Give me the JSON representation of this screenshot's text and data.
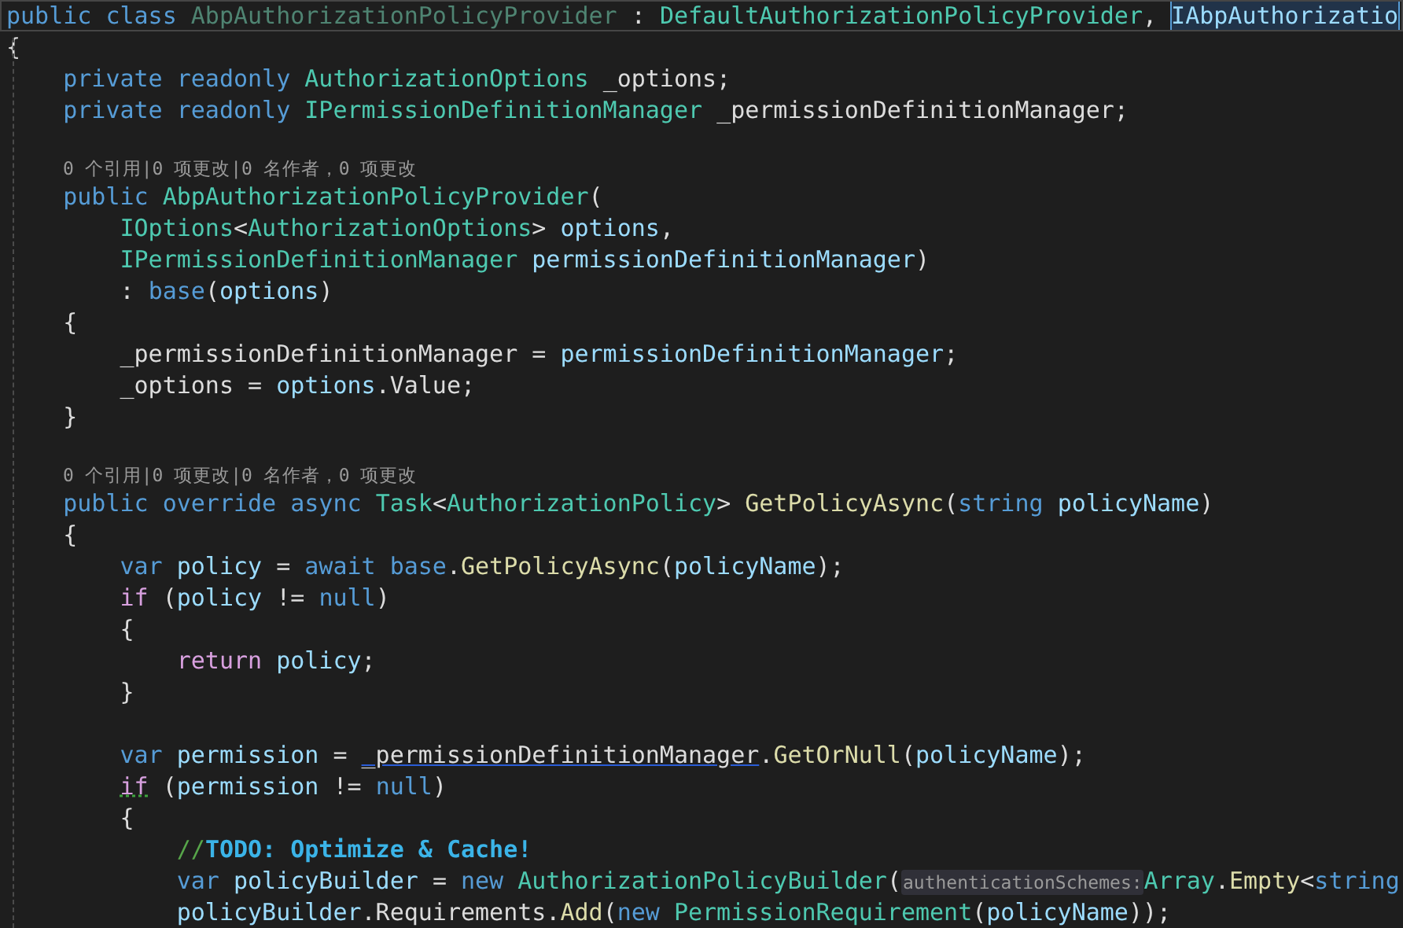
{
  "editor": {
    "lines": [
      {
        "kind": "code",
        "current": true,
        "tokens": [
          {
            "t": "public class ",
            "kind": "kw"
          },
          {
            "t": "AbpAuthorizationPolicyProvider",
            "kind": "dim"
          },
          {
            "t": " : ",
            "kind": "plain"
          },
          {
            "t": "DefaultAuthorizationPolicyProvider",
            "kind": "type"
          },
          {
            "t": ", ",
            "kind": "plain"
          },
          {
            "t": "IAbpAuthorizatio",
            "kind": "selected"
          }
        ]
      },
      {
        "kind": "code",
        "current": false,
        "tokens": [
          {
            "t": "{",
            "kind": "plain"
          }
        ]
      },
      {
        "kind": "code",
        "current": false,
        "tokens": [
          {
            "t": "    private readonly ",
            "kind": "kw"
          },
          {
            "t": "AuthorizationOptions",
            "kind": "type"
          },
          {
            "t": " _options;",
            "kind": "plain"
          }
        ]
      },
      {
        "kind": "code",
        "current": false,
        "tokens": [
          {
            "t": "    private readonly ",
            "kind": "kw"
          },
          {
            "t": "IPermissionDefinitionManager",
            "kind": "type"
          },
          {
            "t": " _permissionDefinitionManager;",
            "kind": "plain"
          }
        ]
      },
      {
        "kind": "blank"
      },
      {
        "kind": "lens",
        "text": "0 个引用|0 项更改|0 名作者，0 项更改"
      },
      {
        "kind": "code",
        "current": false,
        "tokens": [
          {
            "t": "    public ",
            "kind": "kw"
          },
          {
            "t": "AbpAuthorizationPolicyProvider",
            "kind": "type"
          },
          {
            "t": "(",
            "kind": "plain"
          }
        ]
      },
      {
        "kind": "code",
        "current": false,
        "tokens": [
          {
            "t": "        IOptions",
            "kind": "type"
          },
          {
            "t": "<",
            "kind": "plain"
          },
          {
            "t": "AuthorizationOptions",
            "kind": "type"
          },
          {
            "t": "> ",
            "kind": "plain"
          },
          {
            "t": "options",
            "kind": "param"
          },
          {
            "t": ",",
            "kind": "plain"
          }
        ]
      },
      {
        "kind": "code",
        "current": false,
        "tokens": [
          {
            "t": "        IPermissionDefinitionManager",
            "kind": "type"
          },
          {
            "t": " permissionDefinitionManager",
            "kind": "param"
          },
          {
            "t": ")",
            "kind": "plain"
          }
        ]
      },
      {
        "kind": "code",
        "current": false,
        "tokens": [
          {
            "t": "        : ",
            "kind": "plain"
          },
          {
            "t": "base",
            "kind": "kw"
          },
          {
            "t": "(",
            "kind": "plain"
          },
          {
            "t": "options",
            "kind": "param"
          },
          {
            "t": ")",
            "kind": "plain"
          }
        ]
      },
      {
        "kind": "code",
        "current": false,
        "tokens": [
          {
            "t": "    {",
            "kind": "plain"
          }
        ]
      },
      {
        "kind": "code",
        "current": false,
        "tokens": [
          {
            "t": "        _permissionDefinitionManager = ",
            "kind": "plain"
          },
          {
            "t": "permissionDefinitionManager",
            "kind": "param"
          },
          {
            "t": ";",
            "kind": "plain"
          }
        ]
      },
      {
        "kind": "code",
        "current": false,
        "tokens": [
          {
            "t": "        _options = ",
            "kind": "plain"
          },
          {
            "t": "options",
            "kind": "param"
          },
          {
            "t": ".Value;",
            "kind": "plain"
          }
        ]
      },
      {
        "kind": "code",
        "current": false,
        "tokens": [
          {
            "t": "    }",
            "kind": "plain"
          }
        ]
      },
      {
        "kind": "blank"
      },
      {
        "kind": "lens",
        "text": "0 个引用|0 项更改|0 名作者，0 项更改"
      },
      {
        "kind": "code",
        "current": false,
        "tokens": [
          {
            "t": "    public override async ",
            "kind": "kw"
          },
          {
            "t": "Task",
            "kind": "type"
          },
          {
            "t": "<",
            "kind": "plain"
          },
          {
            "t": "AuthorizationPolicy",
            "kind": "type"
          },
          {
            "t": "> ",
            "kind": "plain"
          },
          {
            "t": "GetPolicyAsync",
            "kind": "method"
          },
          {
            "t": "(",
            "kind": "plain"
          },
          {
            "t": "string",
            "kind": "kw"
          },
          {
            "t": " policyName",
            "kind": "param"
          },
          {
            "t": ")",
            "kind": "plain"
          }
        ]
      },
      {
        "kind": "code",
        "current": false,
        "tokens": [
          {
            "t": "    {",
            "kind": "plain"
          }
        ]
      },
      {
        "kind": "code",
        "current": false,
        "tokens": [
          {
            "t": "        var ",
            "kind": "kw"
          },
          {
            "t": "policy",
            "kind": "param"
          },
          {
            "t": " = ",
            "kind": "plain"
          },
          {
            "t": "await base",
            "kind": "kw"
          },
          {
            "t": ".",
            "kind": "plain"
          },
          {
            "t": "GetPolicyAsync",
            "kind": "method"
          },
          {
            "t": "(",
            "kind": "plain"
          },
          {
            "t": "policyName",
            "kind": "param"
          },
          {
            "t": ");",
            "kind": "plain"
          }
        ]
      },
      {
        "kind": "code",
        "current": false,
        "tokens": [
          {
            "t": "        if",
            "kind": "ctrl"
          },
          {
            "t": " (",
            "kind": "plain"
          },
          {
            "t": "policy",
            "kind": "param"
          },
          {
            "t": " != ",
            "kind": "plain"
          },
          {
            "t": "null",
            "kind": "kw"
          },
          {
            "t": ")",
            "kind": "plain"
          }
        ]
      },
      {
        "kind": "code",
        "current": false,
        "tokens": [
          {
            "t": "        {",
            "kind": "plain"
          }
        ]
      },
      {
        "kind": "code",
        "current": false,
        "tokens": [
          {
            "t": "            return",
            "kind": "ctrl"
          },
          {
            "t": " policy",
            "kind": "param"
          },
          {
            "t": ";",
            "kind": "plain"
          }
        ]
      },
      {
        "kind": "code",
        "current": false,
        "tokens": [
          {
            "t": "        }",
            "kind": "plain"
          }
        ]
      },
      {
        "kind": "blank"
      },
      {
        "kind": "code",
        "current": false,
        "tokens": [
          {
            "t": "        var ",
            "kind": "kw"
          },
          {
            "t": "permission",
            "kind": "param"
          },
          {
            "t": " = ",
            "kind": "plain"
          },
          {
            "t": "_permissionDefinitionManager",
            "kind": "underlined"
          },
          {
            "t": ".",
            "kind": "plain"
          },
          {
            "t": "GetOrNull",
            "kind": "method"
          },
          {
            "t": "(",
            "kind": "plain"
          },
          {
            "t": "policyName",
            "kind": "param"
          },
          {
            "t": ");",
            "kind": "plain"
          }
        ]
      },
      {
        "kind": "code",
        "current": false,
        "tokens": [
          {
            "t": "        if",
            "kind": "squiggle"
          },
          {
            "t": " (",
            "kind": "plain"
          },
          {
            "t": "permission",
            "kind": "param"
          },
          {
            "t": " != ",
            "kind": "plain"
          },
          {
            "t": "null",
            "kind": "kw"
          },
          {
            "t": ")",
            "kind": "plain"
          }
        ]
      },
      {
        "kind": "code",
        "current": false,
        "tokens": [
          {
            "t": "        {",
            "kind": "plain"
          }
        ]
      },
      {
        "kind": "code",
        "current": false,
        "tokens": [
          {
            "t": "            //",
            "kind": "comment"
          },
          {
            "t": "TODO: Optimize & Cache!",
            "kind": "todo"
          }
        ]
      },
      {
        "kind": "code",
        "current": false,
        "tokens": [
          {
            "t": "            var ",
            "kind": "kw"
          },
          {
            "t": "policyBuilder",
            "kind": "param"
          },
          {
            "t": " = ",
            "kind": "plain"
          },
          {
            "t": "new",
            "kind": "kw"
          },
          {
            "t": " AuthorizationPolicyBuilder",
            "kind": "type"
          },
          {
            "t": "(",
            "kind": "plain"
          },
          {
            "t": "authenticationSchemes:",
            "kind": "hint"
          },
          {
            "t": "Array",
            "kind": "type"
          },
          {
            "t": ".",
            "kind": "plain"
          },
          {
            "t": "Empty",
            "kind": "method"
          },
          {
            "t": "<",
            "kind": "plain"
          },
          {
            "t": "string",
            "kind": "kw"
          }
        ]
      },
      {
        "kind": "code",
        "current": false,
        "tokens": [
          {
            "t": "            policyBuilder",
            "kind": "param"
          },
          {
            "t": ".Requirements.",
            "kind": "plain"
          },
          {
            "t": "Add",
            "kind": "method"
          },
          {
            "t": "(",
            "kind": "plain"
          },
          {
            "t": "new",
            "kind": "kw"
          },
          {
            "t": " PermissionRequirement",
            "kind": "type"
          },
          {
            "t": "(",
            "kind": "plain"
          },
          {
            "t": "policyName",
            "kind": "param"
          },
          {
            "t": "));",
            "kind": "plain"
          }
        ]
      }
    ]
  }
}
